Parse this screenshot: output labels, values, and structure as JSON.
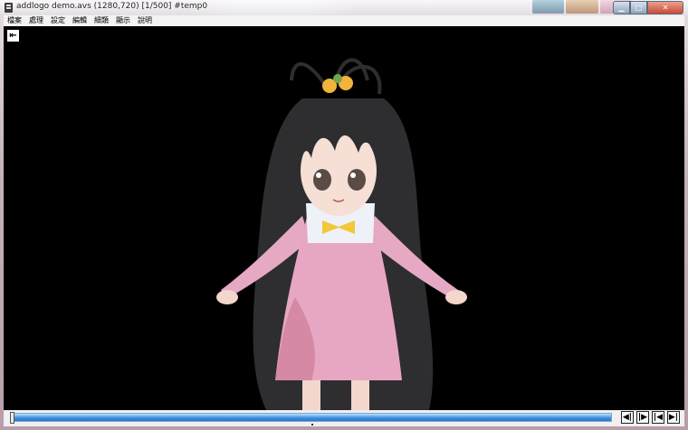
{
  "window": {
    "title": "addlogo demo.avs (1280,720)  [1/500]  #temp0",
    "controls": {
      "minimize": "▁",
      "maximize": "□",
      "close": "✕"
    }
  },
  "menubar": {
    "items": [
      "檔案",
      "處理",
      "設定",
      "編輯",
      "細類",
      "顯示",
      "說明"
    ]
  },
  "video": {
    "back_button_icon": "arrow-left-to-bar-icon",
    "back_button_glyph": "⇤"
  },
  "seekbar": {
    "current_frame": 1,
    "total_frames": 500,
    "fill_fraction": 0.0
  },
  "nav_buttons": [
    {
      "name": "prev-frame",
      "glyph": "◀|"
    },
    {
      "name": "next-frame",
      "glyph": "|▶"
    },
    {
      "name": "first-frame",
      "glyph": "|◀"
    },
    {
      "name": "last-frame",
      "glyph": "▶|"
    }
  ],
  "colors": {
    "seek_fill": "#3d8be0",
    "video_background": "#000000",
    "dress": "#e7a7c2",
    "hair": "#3a3a3c"
  }
}
